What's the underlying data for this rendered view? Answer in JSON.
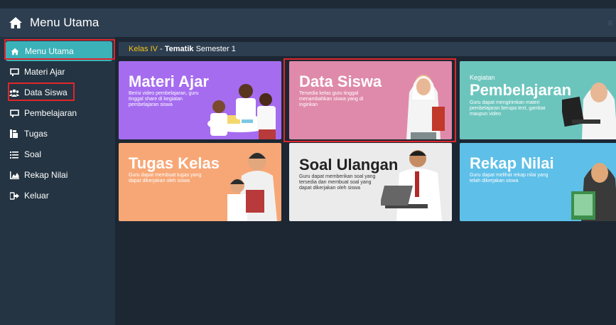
{
  "header": {
    "title": "Menu Utama",
    "menu_icon": "hamburger-icon"
  },
  "sidebar": {
    "items": [
      {
        "label": "Menu Utama",
        "icon": "home-icon",
        "active": true
      },
      {
        "label": "Materi Ajar",
        "icon": "easel-icon"
      },
      {
        "label": "Data Siswa",
        "icon": "users-icon"
      },
      {
        "label": "Pembelajaran",
        "icon": "easel-icon"
      },
      {
        "label": "Tugas",
        "icon": "task-icon"
      },
      {
        "label": "Soal",
        "icon": "list-icon"
      },
      {
        "label": "Rekap Nilai",
        "icon": "chart-icon"
      },
      {
        "label": "Keluar",
        "icon": "logout-icon"
      }
    ]
  },
  "breadcrumb": {
    "kelas": "Kelas IV",
    "sep": " - ",
    "tema": "Tematik",
    "semester": " Semester 1"
  },
  "cards": [
    {
      "title": "Materi Ajar",
      "desc": "Berisi video pembelajaran, guru tinggal share di kegiatan pembelajaran siswa",
      "color": "#a56cf0"
    },
    {
      "title": "Data Siswa",
      "desc": "Tersedia kelas guru tinggal menambahkan siswa yang di inginkan",
      "color": "#df8aaa"
    },
    {
      "subtitle": "Kegiatan",
      "title": "Pembelajaran",
      "desc": "Guru dapat mengirimkan materi pembelajaran berupa text, gambar maupun video",
      "color": "#6cc5bd"
    },
    {
      "title": "Tugas Kelas",
      "desc": "Guru dapat membuat tugas yang dapat dikerjakan oleh siswa",
      "color": "#f7a776"
    },
    {
      "title": "Soal Ulangan",
      "desc": "Guru dapat memberikan soal yang tersedia dan membuat soal yang dapat dikerjakan oleh siswa",
      "color": "#ebebeb"
    },
    {
      "title": "Rekap Nilai",
      "desc": "Guru dapat melihat rekap nilai yang telah dikerjakan siswa",
      "color": "#5ebfe8"
    }
  ],
  "highlight_color": "#e0262b"
}
